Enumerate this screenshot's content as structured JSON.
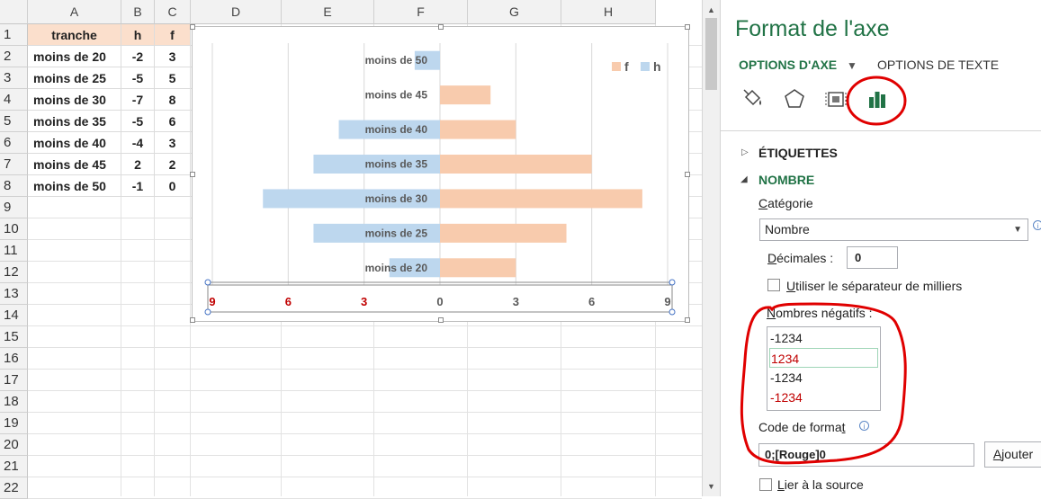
{
  "sheet": {
    "columns": [
      "A",
      "B",
      "C",
      "D",
      "E",
      "F",
      "G",
      "H"
    ],
    "rows": [
      "1",
      "2",
      "3",
      "4",
      "5",
      "6",
      "7",
      "8",
      "9",
      "10",
      "11",
      "12",
      "13",
      "14",
      "15",
      "16",
      "17",
      "18",
      "19",
      "20",
      "21",
      "22"
    ],
    "headers": [
      "tranche",
      "h",
      "f"
    ],
    "data": [
      [
        "moins de 20",
        "-2",
        "3"
      ],
      [
        "moins de 25",
        "-5",
        "5"
      ],
      [
        "moins de 30",
        "-7",
        "8"
      ],
      [
        "moins de 35",
        "-5",
        "6"
      ],
      [
        "moins de 40",
        "-4",
        "3"
      ],
      [
        "moins de 45",
        "2",
        "2"
      ],
      [
        "moins de 50",
        "-1",
        "0"
      ]
    ]
  },
  "chart_data": {
    "type": "bar",
    "orientation": "horizontal",
    "categories": [
      "moins de 50",
      "moins de 45",
      "moins de 40",
      "moins de 35",
      "moins de 30",
      "moins de 25",
      "moins de 20"
    ],
    "series": [
      {
        "name": "f",
        "color": "#f8cbad",
        "values": [
          0,
          2,
          3,
          6,
          8,
          5,
          3
        ]
      },
      {
        "name": "h",
        "color": "#bdd7ee",
        "values": [
          -1,
          2,
          -4,
          -5,
          -7,
          -5,
          -2
        ]
      }
    ],
    "xlim": [
      -9,
      9
    ],
    "xticks": [
      -9,
      -6,
      -3,
      0,
      3,
      6,
      9
    ],
    "xtick_labels": [
      "9",
      "6",
      "3",
      "0",
      "3",
      "6",
      "9"
    ],
    "negative_label_color": "#c00000",
    "legend": "top-right",
    "grid": true
  },
  "scrollbar": {
    "up": "▲",
    "down": "▼"
  },
  "panel": {
    "title": "Format de l'axe",
    "tab_axis": "OPTIONS D'AXE",
    "tab_axis_arrow": "▼",
    "tab_text": "OPTIONS DE TEXTE",
    "section_labels": "ÉTIQUETTES",
    "section_number": "NOMBRE",
    "arrow_collapsed": "▷",
    "arrow_expanded": "◢",
    "category_label_first": "C",
    "category_label_rest": "atégorie",
    "category_value": "Nombre",
    "dropdown_arrow": "▼",
    "decimals_label_first": "D",
    "decimals_label_rest": "écimales :",
    "decimals_value": "0",
    "thousands_label_first": "U",
    "thousands_label_rest": "tiliser le séparateur de milliers",
    "negative_label_first": "N",
    "negative_label_rest": "ombres négatifs :",
    "negative_options": [
      {
        "text": "-1234",
        "color": "#222222"
      },
      {
        "text": "1234",
        "color": "#c00000"
      },
      {
        "text": "-1234",
        "color": "#222222"
      },
      {
        "text": "-1234",
        "color": "#c00000"
      }
    ],
    "format_code_label_main": "Code de forma",
    "format_code_label_last": "t",
    "format_code_value": "0;[Rouge]0",
    "add_label_first": "A",
    "add_label_rest": "jouter",
    "link_source_label_first": "L",
    "link_source_label_rest": "ier à la source",
    "info_glyph": "i"
  }
}
